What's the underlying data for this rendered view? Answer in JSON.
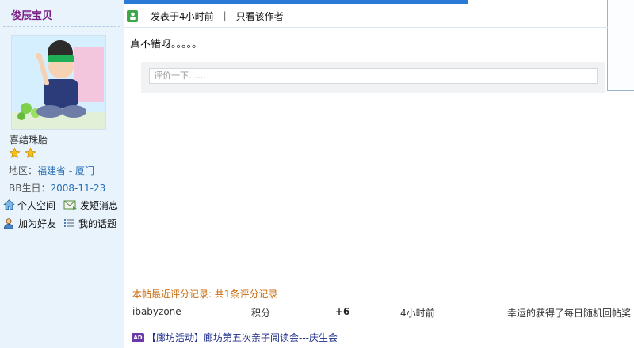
{
  "user": {
    "name": "俊辰宝贝",
    "title": "喜结珠胎",
    "stars": 2,
    "region_label": "地区：",
    "region_province": "福建省",
    "region_city": " - 厦门",
    "birthday_label": "BB生日：",
    "birthday_value": "2008-11-23"
  },
  "actions": {
    "space": "个人空间",
    "message": "发短消息",
    "friend": "加为好友",
    "topics": "我的话题"
  },
  "post": {
    "posted": "发表于4小时前",
    "separator": "|",
    "only_author": "只看该作者",
    "content": "真不错呀。。。。。",
    "comment_placeholder": "评价一下……"
  },
  "ratings": {
    "title": "本帖最近评分记录: 共1条评分记录",
    "rows": [
      {
        "user": "ibabyzone",
        "type": "积分",
        "value": "+6",
        "time": "4小时前",
        "reason": "幸运的获得了每日随机回帖奖"
      }
    ]
  },
  "ad": {
    "icon_text": "AD",
    "text": "【廊坊活动】廊坊第五次亲子阅读会---庆生会"
  },
  "colors": {
    "accent_blue": "#2b78d5",
    "username_purple": "#7a1e86",
    "rating_orange": "#c8690a",
    "link_blue": "#2b6fb5"
  }
}
